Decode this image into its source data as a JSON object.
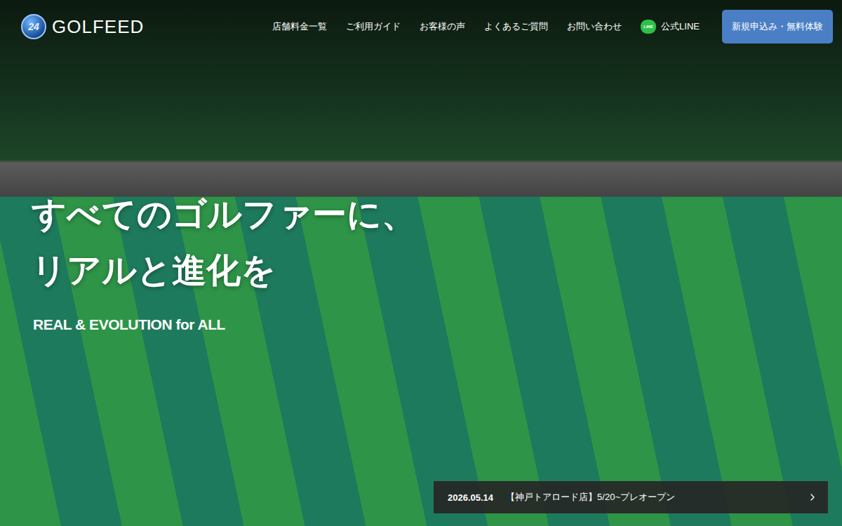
{
  "header": {
    "logo": {
      "badge": "24",
      "name": "GOLFEED"
    },
    "nav": [
      {
        "label": "店舗料金一覧"
      },
      {
        "label": "ご利用ガイド"
      },
      {
        "label": "お客様の声"
      },
      {
        "label": "よくあるご質問"
      },
      {
        "label": "お問い合わせ"
      }
    ],
    "line": {
      "icon_text": "LINE",
      "label": "公式LINE"
    },
    "cta": "新規申込み・無料体験"
  },
  "hero": {
    "title_lines": [
      "すべてのゴルファーに、",
      "リアルと進化を"
    ],
    "subtitle": "REAL & EVOLUTION for ALL"
  },
  "news": {
    "date": "2026.05.14",
    "text": "【神戸トアロード店】5/20~プレオープン"
  }
}
